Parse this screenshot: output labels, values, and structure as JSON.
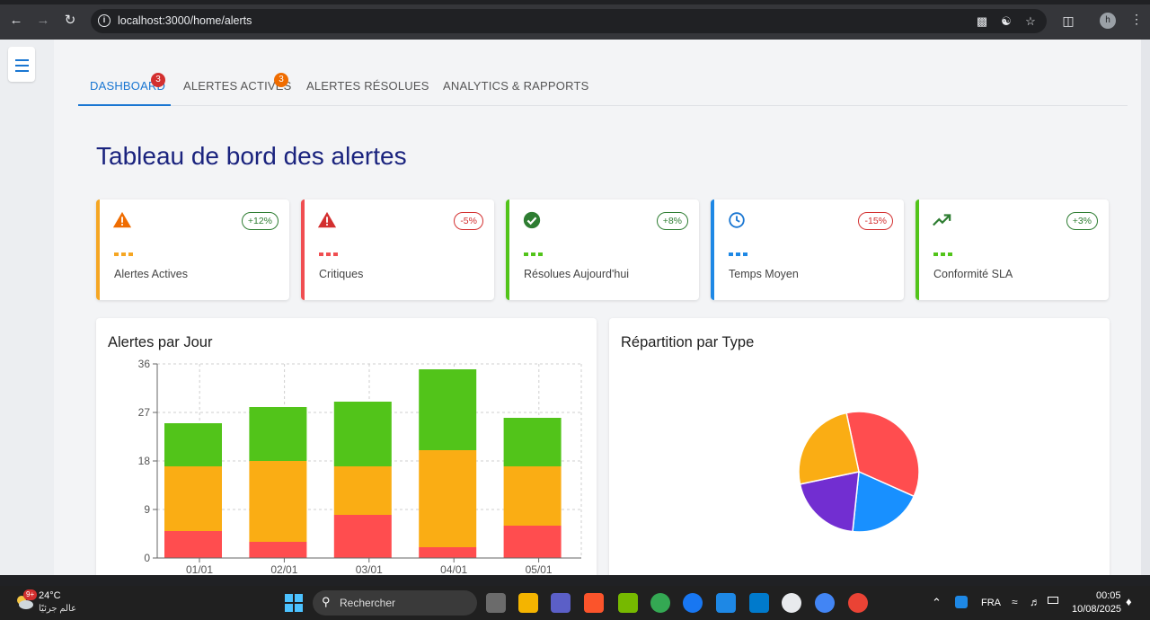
{
  "browser": {
    "url": "localhost:3000/home/alerts",
    "profile_initial": "h"
  },
  "tabs": [
    {
      "label": "DASHBOARD",
      "badge": "3",
      "badge_color": "#d32f2f"
    },
    {
      "label": "ALERTES ACTIVES",
      "badge": "3",
      "badge_color": "#ef6c00"
    },
    {
      "label": "ALERTES RÉSOLUES"
    },
    {
      "label": "ANALYTICS & RAPPORTS"
    }
  ],
  "page_title": "Tableau de bord des alertes",
  "kpis": [
    {
      "label": "Alertes Actives",
      "change": "+12%",
      "color": "#f5a623",
      "trend": "up",
      "icon": "warning-icon"
    },
    {
      "label": "Critiques",
      "change": "-5%",
      "color": "#f04e51",
      "trend": "down",
      "icon": "warning-icon"
    },
    {
      "label": "Résolues Aujourd'hui",
      "change": "+8%",
      "color": "#52c41a",
      "trend": "up",
      "icon": "check-circle-icon"
    },
    {
      "label": "Temps Moyen",
      "change": "-15%",
      "color": "#1e88e5",
      "trend": "down",
      "icon": "clock-icon"
    },
    {
      "label": "Conformité SLA",
      "change": "+3%",
      "color": "#52c41a",
      "trend": "up",
      "icon": "trending-up-icon"
    }
  ],
  "bar_panel_title": "Alertes par Jour",
  "pie_panel_title": "Répartition par Type",
  "chart_data": [
    {
      "type": "bar",
      "stacked": true,
      "categories": [
        "01/01",
        "02/01",
        "03/01",
        "04/01",
        "05/01"
      ],
      "ylim": [
        0,
        36
      ],
      "yticks": [
        0,
        9,
        18,
        27,
        36
      ],
      "grid": true,
      "series": [
        {
          "color": "#ff4d4f",
          "values": [
            5,
            3,
            8,
            2,
            6
          ]
        },
        {
          "color": "#faad14",
          "values": [
            12,
            15,
            9,
            18,
            11
          ]
        },
        {
          "color": "#52c41a",
          "values": [
            8,
            10,
            12,
            15,
            9
          ]
        }
      ]
    },
    {
      "type": "pie",
      "slices": [
        {
          "color": "#ff4d4f",
          "value": 35
        },
        {
          "color": "#1890ff",
          "value": 20
        },
        {
          "color": "#722ed1",
          "value": 20
        },
        {
          "color": "#faad14",
          "value": 25
        }
      ]
    }
  ],
  "taskbar": {
    "weather_temp": "24°C",
    "weather_desc": "عالم جرئيًا",
    "weather_badge": "9+",
    "search_placeholder": "Rechercher",
    "language": "FRA",
    "time": "00:05",
    "date": "10/08/2025"
  }
}
